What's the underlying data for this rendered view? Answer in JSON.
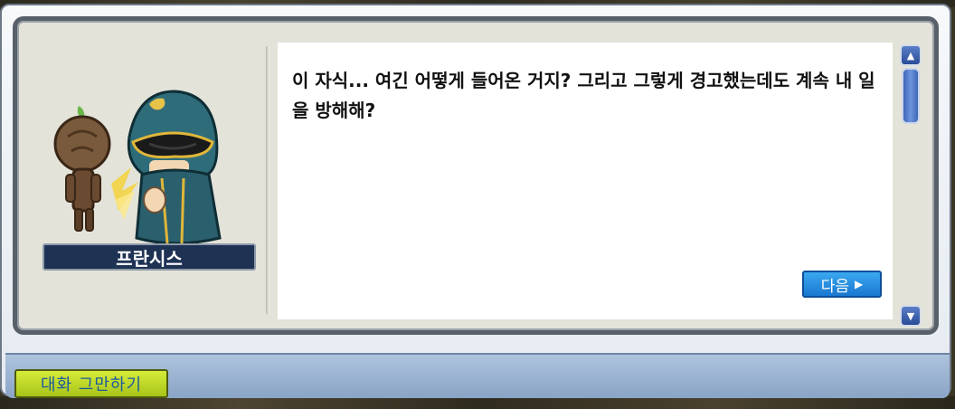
{
  "npc": {
    "name": "프란시스"
  },
  "dialog": {
    "text": "이 자식... 여긴 어떻게 들어온 거지? 그리고 그렇게 경고했는데도 계속 내 일을 방해해?",
    "next_label": "다음",
    "next_icon": "triangle-right-icon"
  },
  "scrollbar": {
    "up_icon": "scroll-up-arrow-icon",
    "down_icon": "scroll-down-arrow-icon"
  },
  "footer": {
    "end_chat_label": "대화 그만하기"
  },
  "colors": {
    "name_plate_bg": "#1e3254",
    "next_button": "#1a78d0",
    "end_chat_button": "#c4dc28",
    "frame_border": "#58606a"
  }
}
